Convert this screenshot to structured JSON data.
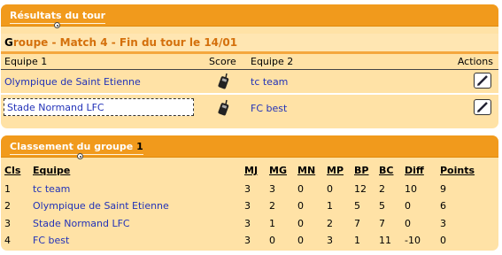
{
  "results": {
    "title": "Résultats du tour",
    "group_title_first": "G",
    "group_title_rest": "roupe - Match 4 - Fin du tour le 14/01",
    "columns": {
      "team1": "Equipe 1",
      "score": "Score",
      "team2": "Equipe 2",
      "actions": "Actions"
    },
    "matches": [
      {
        "team1": "Olympique de Saint Etienne",
        "team2": "tc team"
      },
      {
        "team1": "Stade Normand LFC",
        "team2": "FC best"
      }
    ]
  },
  "ranking": {
    "title": "Classement du groupe",
    "group_number": "1",
    "headers": [
      "Cls",
      "Equipe",
      "MJ",
      "MG",
      "MN",
      "MP",
      "BP",
      "BC",
      "Diff",
      "Points"
    ],
    "rows": [
      {
        "cls": "1",
        "team": "tc team",
        "mj": "3",
        "mg": "3",
        "mn": "0",
        "mp": "0",
        "bp": "12",
        "bc": "2",
        "diff": "10",
        "points": "9"
      },
      {
        "cls": "2",
        "team": "Olympique de Saint Etienne",
        "mj": "3",
        "mg": "2",
        "mn": "0",
        "mp": "1",
        "bp": "5",
        "bc": "5",
        "diff": "0",
        "points": "6"
      },
      {
        "cls": "3",
        "team": "Stade Normand LFC",
        "mj": "3",
        "mg": "1",
        "mn": "0",
        "mp": "2",
        "bp": "7",
        "bc": "7",
        "diff": "0",
        "points": "3"
      },
      {
        "cls": "4",
        "team": "FC best",
        "mj": "3",
        "mg": "0",
        "mn": "0",
        "mp": "3",
        "bp": "1",
        "bc": "11",
        "diff": "-10",
        "points": "0"
      }
    ]
  },
  "colors": {
    "accent": "#f19a1c",
    "panel_bg": "#ffe2a6",
    "link": "#2232b8",
    "group_title": "#d4700c"
  },
  "icons": {
    "score": "phone-icon",
    "edit": "pencil-icon",
    "header": "soccer-ball-icon"
  }
}
